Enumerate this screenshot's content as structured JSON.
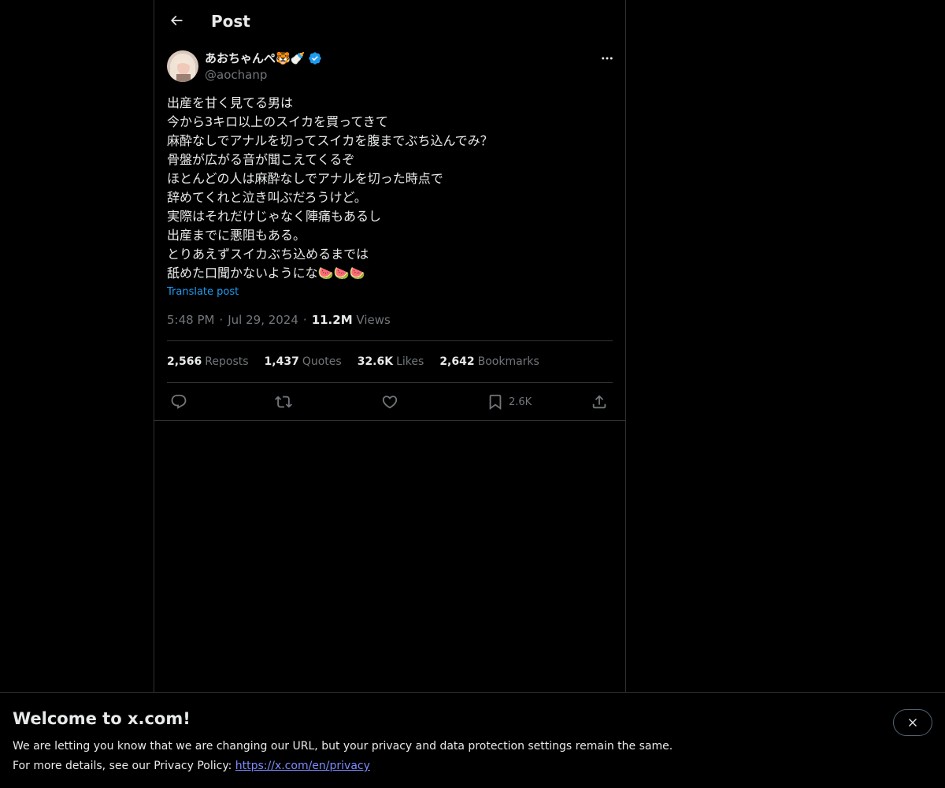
{
  "header": {
    "title": "Post"
  },
  "author": {
    "display_name": "あおちゃんぺ🐯🍼",
    "handle": "@aochanp"
  },
  "post": {
    "lines": [
      "出産を甘く見てる男は",
      "今から3キロ以上のスイカを買ってきて",
      "麻酔なしでアナルを切ってスイカを腹までぶち込んでみ？",
      "骨盤が広がる音が聞こえてくるぞ",
      "ほとんどの人は麻酔なしでアナルを切った時点で",
      "辞めてくれと泣き叫ぶだろうけど。",
      "実際はそれだけじゃなく陣痛もあるし",
      "出産までに悪阻もある。",
      "とりあえずスイカぶち込めるまでは",
      "舐めた口聞かないようにな🍉🍉🍉"
    ],
    "translate_label": "Translate post",
    "time": "5:48 PM",
    "date": "Jul 29, 2024",
    "separator": "·",
    "views_count": "11.2M",
    "views_label": "Views"
  },
  "stats": {
    "reposts_count": "2,566",
    "reposts_label": "Reposts",
    "quotes_count": "1,437",
    "quotes_label": "Quotes",
    "likes_count": "32.6K",
    "likes_label": "Likes",
    "bookmarks_count": "2,642",
    "bookmarks_label": "Bookmarks"
  },
  "actions": {
    "bookmark_count": "2.6K"
  },
  "banner": {
    "title": "Welcome to x.com!",
    "line1": "We are letting you know that we are changing our URL, but your privacy and data protection settings remain the same.",
    "line2_prefix": "For more details, see our Privacy Policy: ",
    "link": "https://x.com/en/privacy"
  },
  "colors": {
    "background": "#000000",
    "text": "#e7e9ea",
    "muted": "#71767b",
    "accent": "#1d9bf0",
    "border": "#2f3336",
    "link": "#7c8cff"
  },
  "icons": [
    "back-arrow-icon",
    "verified-badge-icon",
    "more-icon",
    "reply-icon",
    "repost-icon",
    "like-icon",
    "bookmark-icon",
    "share-icon",
    "close-icon"
  ]
}
